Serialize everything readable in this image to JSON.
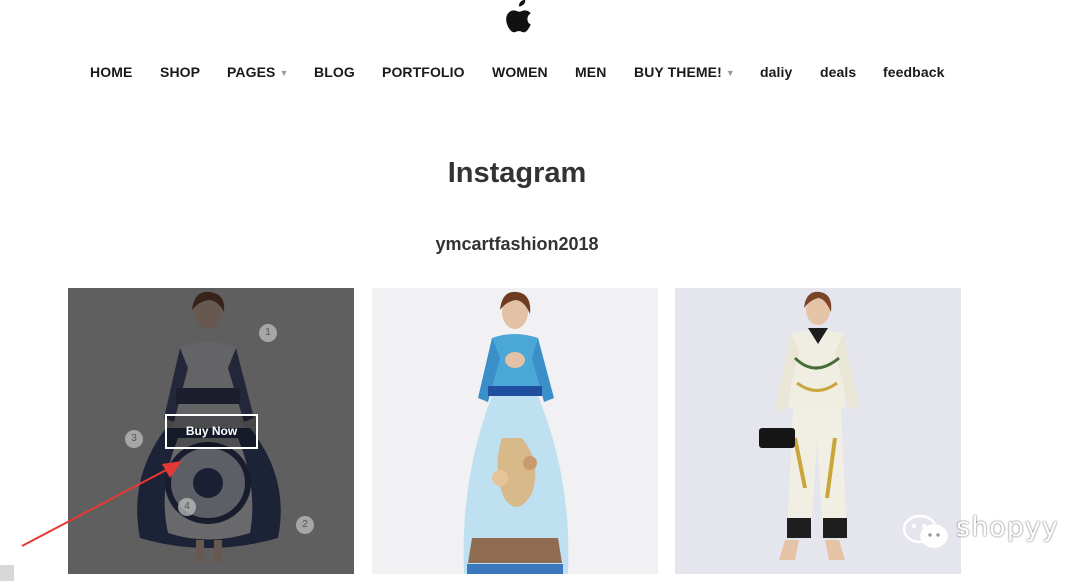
{
  "nav": {
    "items": [
      {
        "label": "HOME",
        "dropdown": false
      },
      {
        "label": "SHOP",
        "dropdown": false
      },
      {
        "label": "PAGES",
        "dropdown": true
      },
      {
        "label": "BLOG",
        "dropdown": false
      },
      {
        "label": "PORTFOLIO",
        "dropdown": false
      },
      {
        "label": "WOMEN",
        "dropdown": false
      },
      {
        "label": "MEN",
        "dropdown": false
      },
      {
        "label": "BUY THEME!",
        "dropdown": true
      },
      {
        "label": "daliy",
        "dropdown": false
      },
      {
        "label": "deals",
        "dropdown": false
      },
      {
        "label": "feedback",
        "dropdown": false
      }
    ],
    "caret": "▼"
  },
  "section": {
    "title": "Instagram",
    "handle": "ymcartfashion2018"
  },
  "tiles": [
    {
      "hotspots": [
        "1",
        "2",
        "3",
        "4"
      ],
      "button_label": "Buy Now"
    }
  ],
  "watermark": {
    "text": "shopyy",
    "icon": "wechat-icon"
  },
  "colors": {
    "arrow": "#e53935",
    "overlay": "#141414"
  }
}
